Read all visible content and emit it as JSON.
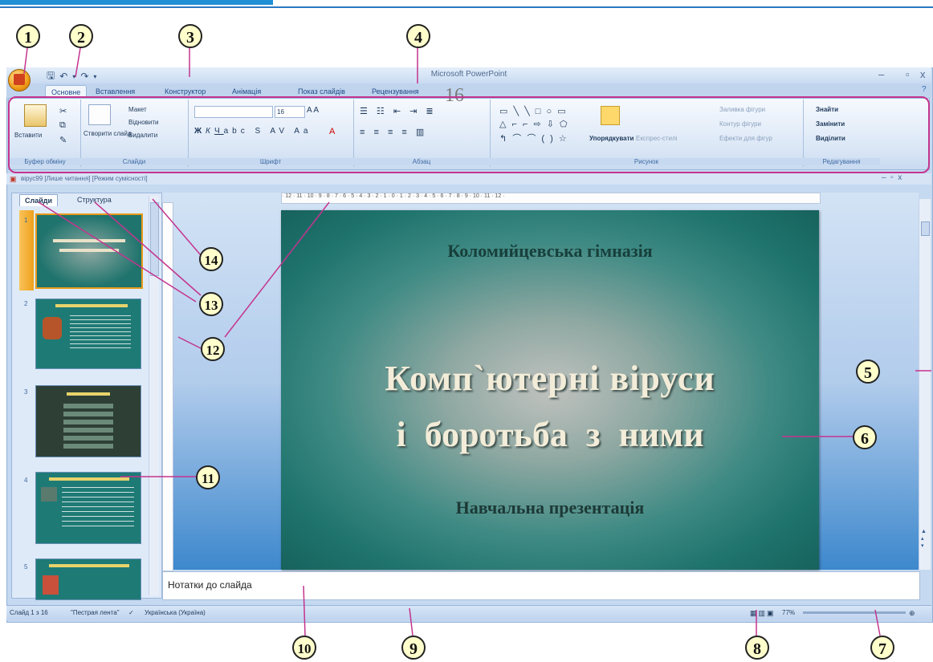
{
  "window": {
    "title": "Microsoft PowerPoint",
    "minimize": "–",
    "close": "x"
  },
  "quick_access": {
    "save_icon": "save-icon",
    "undo_icon": "undo-icon",
    "redo_icon": "redo-icon",
    "customize_icon": "dropdown-icon"
  },
  "ribbon": {
    "tabs": [
      "Основне",
      "Вставлення",
      "Конструктор",
      "Анімація",
      "Показ слайдів",
      "Рецензування"
    ],
    "active_tab": "Основне",
    "overlay_number": "16",
    "groups": {
      "clipboard": {
        "label": "Буфер обміну",
        "paste": "Вставити"
      },
      "slides": {
        "label": "Слайди",
        "new_slide": "Створити слайд",
        "layout": "Макет",
        "reset": "Відновити",
        "delete": "Видалити"
      },
      "font": {
        "label": "Шрифт",
        "size": "16"
      },
      "paragraph": {
        "label": "Абзац"
      },
      "drawing": {
        "label": "Рисунок",
        "arrange": "Упорядкувати",
        "quick_styles": "Експрес-стилі",
        "shape_fill": "Заливка фігури",
        "shape_outline": "Контур фігури",
        "shape_effects": "Ефекти для фігур"
      },
      "editing": {
        "label": "Редагування",
        "find": "Знайти",
        "replace": "Замінити",
        "select": "Виділити"
      }
    }
  },
  "document": {
    "name": "вірус99 [Лише читання] [Режим сумісності]"
  },
  "left_pane": {
    "tabs": [
      "Слайди",
      "Структура"
    ],
    "thumbnails": [
      "1",
      "2",
      "3",
      "4",
      "5"
    ]
  },
  "ruler": {
    "marks": "· 12 · 11 · 10 · 9 · 8 · 7 · 6 · 5 · 4 · 3 · 2 · 1 · 0 · 1 · 2 · 3 · 4 · 5 · 6 · 7 · 8 · 9 · 10 · 11 · 12 ·"
  },
  "slide": {
    "school": "Коломийцевська гімназія",
    "title_line1": "Комп`ютерні віруси",
    "title_line2": "і боротьба з ними",
    "subtitle": "Навчальна презентація"
  },
  "notes": {
    "placeholder": "Нотатки до слайда"
  },
  "status_bar": {
    "slide_counter": "Слайд 1 з 16",
    "theme": "\"Пестрая лента\"",
    "language": "Українська (Україна)",
    "zoom": "77%"
  },
  "callouts": [
    "1",
    "2",
    "3",
    "4",
    "5",
    "6",
    "7",
    "8",
    "9",
    "10",
    "11",
    "12",
    "13",
    "14"
  ],
  "colors": {
    "callout_line": "#c4348e",
    "slide_teal": "#1f746d",
    "ribbon_blue": "#c9dbf1"
  }
}
